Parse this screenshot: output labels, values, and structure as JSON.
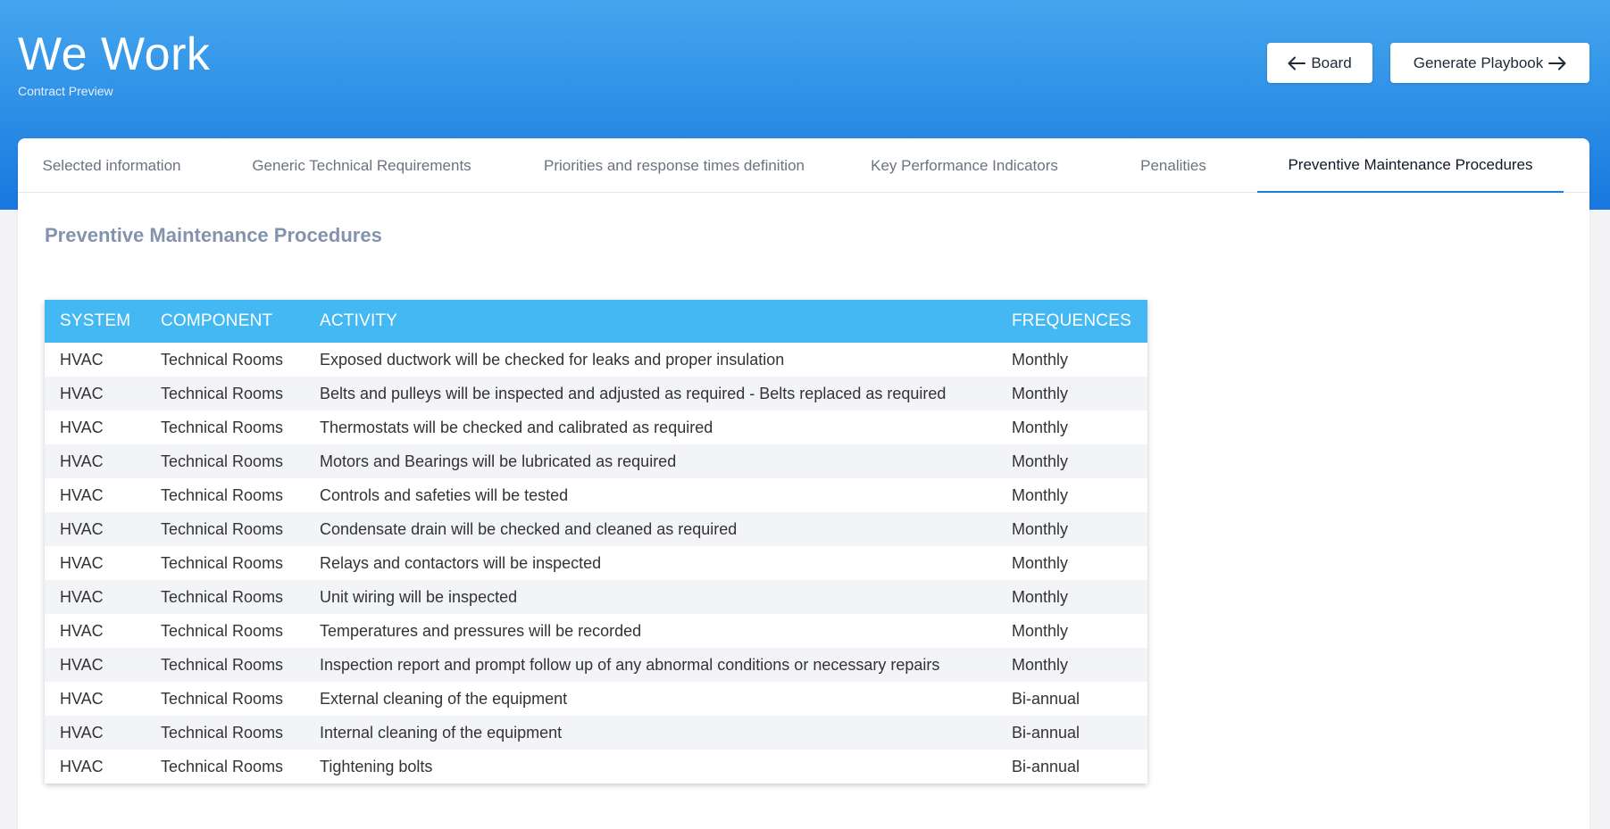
{
  "header": {
    "title": "We Work",
    "subtitle": "Contract Preview",
    "board_label": "Board",
    "playbook_label": "Generate Playbook"
  },
  "tabs": [
    {
      "label": "Selected information",
      "active": false
    },
    {
      "label": "Generic Technical Requirements",
      "active": false
    },
    {
      "label": "Priorities and response times definition",
      "active": false
    },
    {
      "label": "Key Performance Indicators",
      "active": false
    },
    {
      "label": "Penalities",
      "active": false
    },
    {
      "label": "Preventive Maintenance Procedures",
      "active": true
    }
  ],
  "section": {
    "title": "Preventive Maintenance Procedures"
  },
  "table": {
    "columns": [
      "SYSTEM",
      "COMPONENT",
      "ACTIVITY",
      "FREQUENCES"
    ],
    "rows": [
      [
        "HVAC",
        "Technical Rooms",
        "Exposed ductwork will be checked for leaks and proper insulation",
        "Monthly"
      ],
      [
        "HVAC",
        "Technical Rooms",
        "Belts and pulleys will be inspected and adjusted as required - Belts replaced as required",
        "Monthly"
      ],
      [
        "HVAC",
        "Technical Rooms",
        "Thermostats will be checked and calibrated as required",
        "Monthly"
      ],
      [
        "HVAC",
        "Technical Rooms",
        "Motors and Bearings will be lubricated as required",
        "Monthly"
      ],
      [
        "HVAC",
        "Technical Rooms",
        "Controls and safeties will be tested",
        "Monthly"
      ],
      [
        "HVAC",
        "Technical Rooms",
        "Condensate drain will be checked and cleaned as required",
        "Monthly"
      ],
      [
        "HVAC",
        "Technical Rooms",
        "Relays and contactors will be inspected",
        "Monthly"
      ],
      [
        "HVAC",
        "Technical Rooms",
        "Unit wiring will be inspected",
        "Monthly"
      ],
      [
        "HVAC",
        "Technical Rooms",
        "Temperatures and pressures will be recorded",
        "Monthly"
      ],
      [
        "HVAC",
        "Technical Rooms",
        "Inspection report and prompt follow up of any abnormal conditions or necessary repairs",
        "Monthly"
      ],
      [
        "HVAC",
        "Technical Rooms",
        "External cleaning of the equipment",
        "Bi-annual"
      ],
      [
        "HVAC",
        "Technical Rooms",
        "Internal cleaning of the equipment",
        "Bi-annual"
      ],
      [
        "HVAC",
        "Technical Rooms",
        "Tightening bolts",
        "Bi-annual"
      ]
    ]
  },
  "icons": {
    "board": "arrow-left-icon",
    "playbook": "arrow-right-icon"
  },
  "colors": {
    "header_gradient_top": "#45a5ee",
    "header_gradient_bottom": "#1877dd",
    "table_header": "#44b8f3",
    "active_tab_underline": "#1a7de0",
    "section_title": "#8493ad"
  }
}
